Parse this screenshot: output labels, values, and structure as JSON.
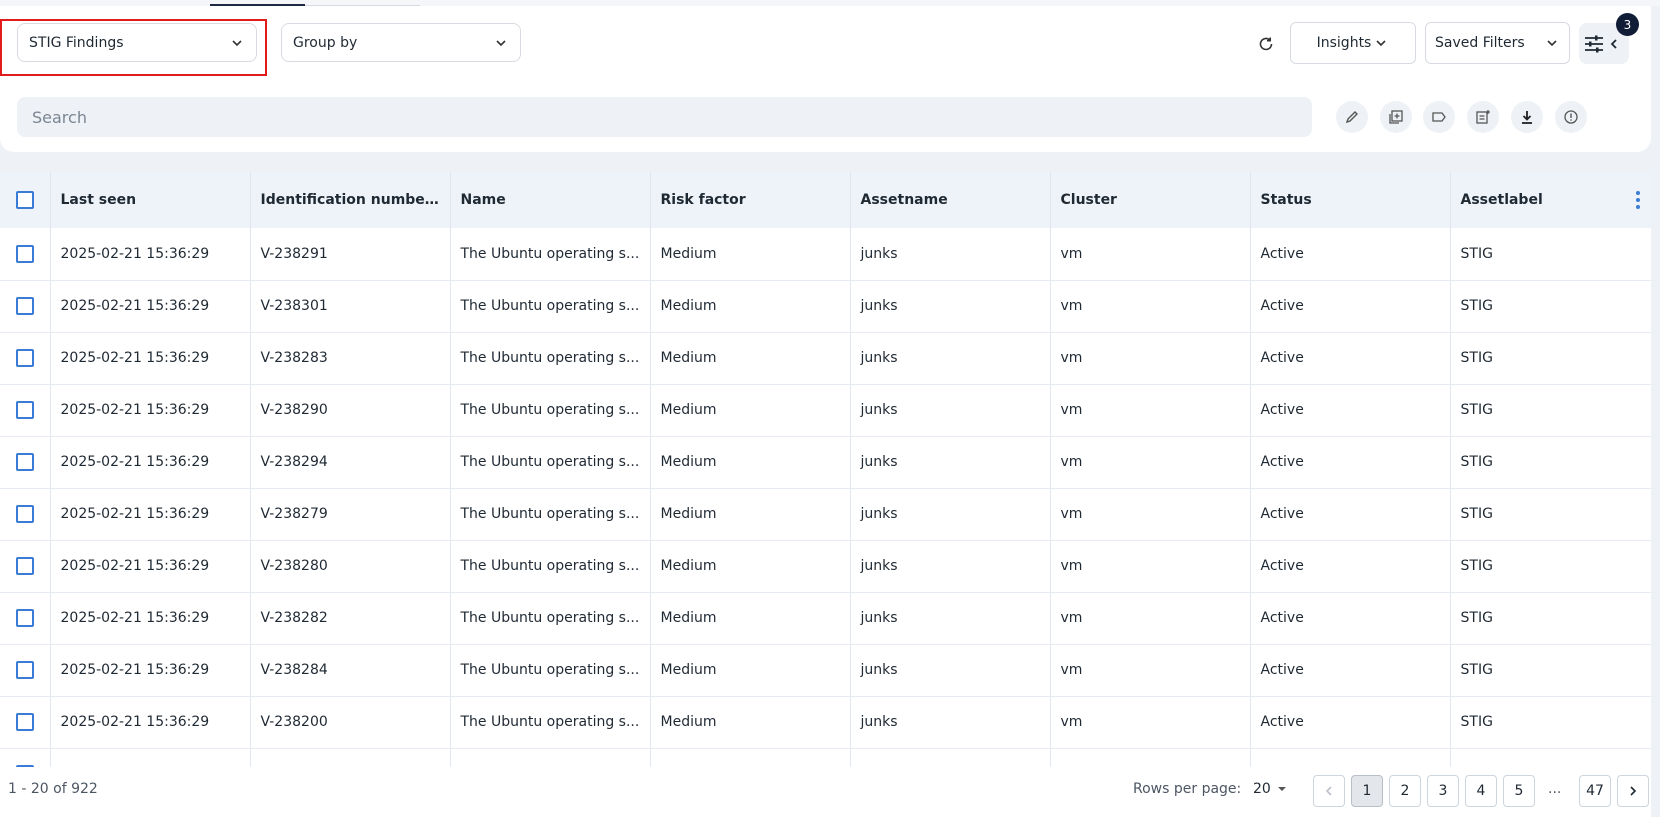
{
  "toolbar": {
    "view_select": "STIG Findings",
    "group_select": "Group by",
    "insights_label": "Insights",
    "saved_filters_label": "Saved Filters",
    "filter_badge_count": "3"
  },
  "search": {
    "placeholder": "Search"
  },
  "action_icons": [
    "edit-icon",
    "add-to-group-icon",
    "tag-icon",
    "add-note-icon",
    "download-icon",
    "info-icon"
  ],
  "table": {
    "headers": [
      "Last seen",
      "Identification numbers",
      "Name",
      "Risk factor",
      "Assetname",
      "Cluster",
      "Status",
      "Assetlabel"
    ],
    "rows": [
      [
        "2025-02-21 15:36:29",
        "V-238291",
        "The Ubuntu operating s...",
        "Medium",
        "junks",
        "vm",
        "Active",
        "STIG"
      ],
      [
        "2025-02-21 15:36:29",
        "V-238301",
        "The Ubuntu operating s...",
        "Medium",
        "junks",
        "vm",
        "Active",
        "STIG"
      ],
      [
        "2025-02-21 15:36:29",
        "V-238283",
        "The Ubuntu operating s...",
        "Medium",
        "junks",
        "vm",
        "Active",
        "STIG"
      ],
      [
        "2025-02-21 15:36:29",
        "V-238290",
        "The Ubuntu operating s...",
        "Medium",
        "junks",
        "vm",
        "Active",
        "STIG"
      ],
      [
        "2025-02-21 15:36:29",
        "V-238294",
        "The Ubuntu operating s...",
        "Medium",
        "junks",
        "vm",
        "Active",
        "STIG"
      ],
      [
        "2025-02-21 15:36:29",
        "V-238279",
        "The Ubuntu operating s...",
        "Medium",
        "junks",
        "vm",
        "Active",
        "STIG"
      ],
      [
        "2025-02-21 15:36:29",
        "V-238280",
        "The Ubuntu operating s...",
        "Medium",
        "junks",
        "vm",
        "Active",
        "STIG"
      ],
      [
        "2025-02-21 15:36:29",
        "V-238282",
        "The Ubuntu operating s...",
        "Medium",
        "junks",
        "vm",
        "Active",
        "STIG"
      ],
      [
        "2025-02-21 15:36:29",
        "V-238284",
        "The Ubuntu operating s...",
        "Medium",
        "junks",
        "vm",
        "Active",
        "STIG"
      ],
      [
        "2025-02-21 15:36:29",
        "V-238200",
        "The Ubuntu operating s...",
        "Medium",
        "junks",
        "vm",
        "Active",
        "STIG"
      ],
      [
        "",
        "",
        "",
        "",
        "",
        "",
        "",
        ""
      ]
    ]
  },
  "footer": {
    "range": "1 - 20 of 922",
    "rows_per_page_label": "Rows per page:",
    "rows_per_page_value": "20",
    "pages": [
      "1",
      "2",
      "3",
      "4",
      "5"
    ],
    "ellipsis": "...",
    "last_page": "47",
    "current_page": "1"
  },
  "colors": {
    "accent": "#3a7bd5",
    "highlight": "#e21b1b",
    "badge": "#111c36"
  }
}
